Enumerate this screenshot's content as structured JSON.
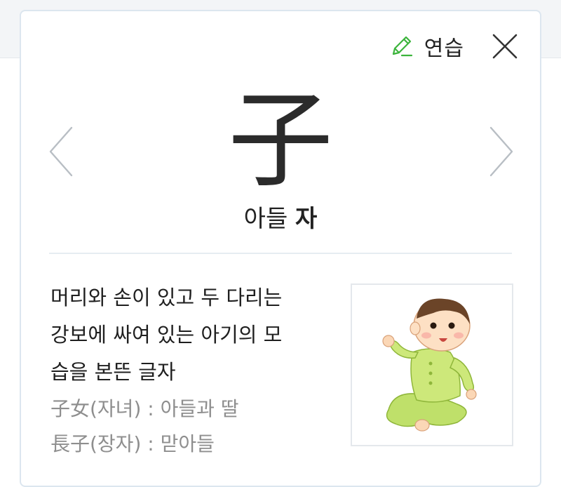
{
  "header": {
    "practice_label": "연습",
    "practice_icon": "pencil-icon",
    "close_icon": "close-icon"
  },
  "character": {
    "hanja": "子",
    "meaning": "아들",
    "sound": "자"
  },
  "navigation": {
    "prev_icon": "chevron-left-icon",
    "next_icon": "chevron-right-icon"
  },
  "description": {
    "lines": [
      "머리와 손이 있고 두 다리는",
      "강보에 싸여 있는 아기의 모",
      "습을 본뜬 글자"
    ]
  },
  "examples": [
    "子女(자녀) : 아들과 딸",
    "長子(장자) : 맏아들"
  ],
  "illustration": {
    "subject": "baby-in-green-pajamas"
  },
  "colors": {
    "accent_green": "#3cb43c",
    "text_main": "#222222",
    "text_muted": "#8e8e8e",
    "border": "#dce6ef"
  }
}
